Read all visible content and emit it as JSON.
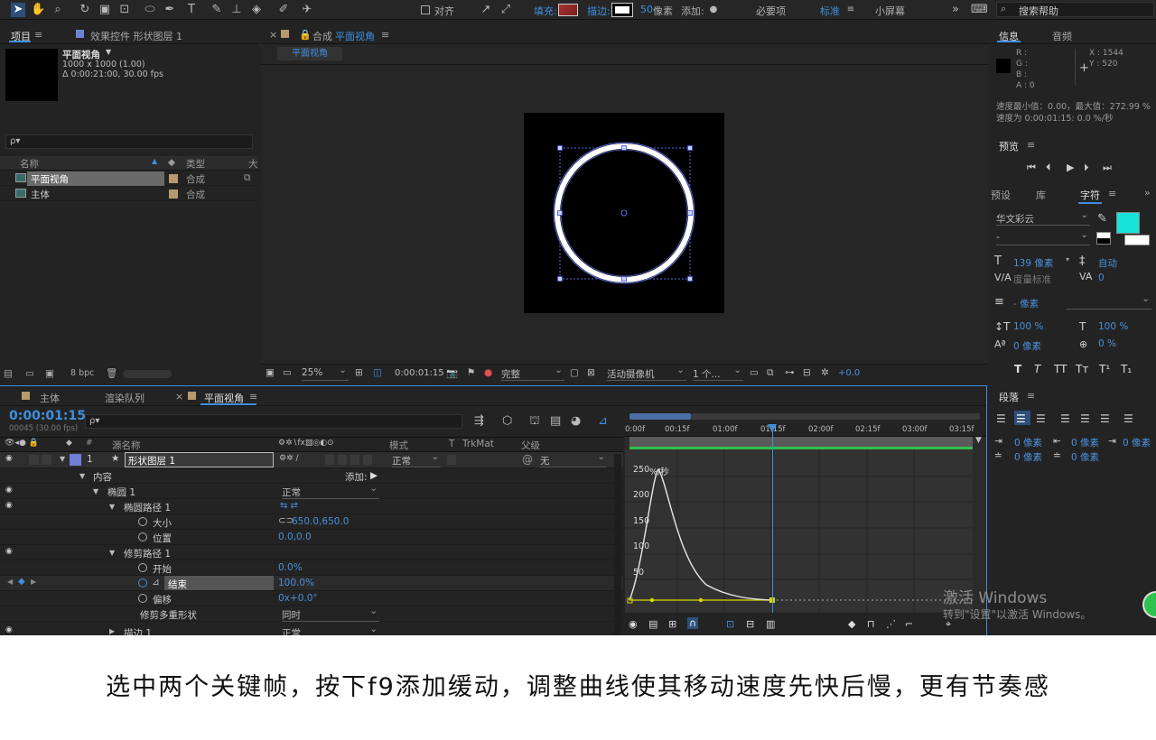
{
  "toolbar": {
    "align_label": "对齐",
    "fill_label": "填充:",
    "stroke_label": "描边:",
    "stroke_width": "50",
    "stroke_unit": "像素",
    "add_label": "添加:",
    "workspaces": [
      "必要项",
      "标准",
      "小屏幕"
    ],
    "search_placeholder": "搜索帮助"
  },
  "project_panel": {
    "tab_project": "项目",
    "tab_effects": "效果控件 形状图层 1",
    "comp_name": "平面视角",
    "comp_dims": "1000 x 1000 (1.00)",
    "comp_duration": "Δ 0:00:21:00, 30.00 fps",
    "search_placeholder": "ρ▾",
    "col_name": "名称",
    "col_type": "类型",
    "col_size": "大",
    "items": [
      {
        "name": "平面视角",
        "type": "合成"
      },
      {
        "name": "主体",
        "type": "合成"
      }
    ],
    "bpc": "8 bpc"
  },
  "comp_panel": {
    "tab_prefix": "合成",
    "tab_name": "平面视角",
    "sub_tab": "平面视角",
    "zoom": "25%",
    "timecode": "0:00:01:15",
    "quality": "完整",
    "camera": "活动摄像机",
    "views": "1 个...",
    "exposure": "+0.0"
  },
  "info_panel": {
    "tab_info": "信息",
    "tab_audio": "音频",
    "r": "R :",
    "g": "G :",
    "b": "B :",
    "a": "A : 0",
    "x": "X : 1544",
    "y": "Y : 520",
    "speed_line1": "速度最小值：0.00，最大值：272.99 %",
    "speed_line2": "速度为 0:00:01:15: 0.0 %/秒"
  },
  "preview_panel": {
    "title": "预览"
  },
  "char_panel": {
    "tab_presets": "预设",
    "tab_library": "库",
    "tab_character": "字符",
    "font": "华文彩云",
    "style": "-",
    "size": "139 像素",
    "leading": "自动",
    "kerning": "度量标准",
    "tracking": "0",
    "stroke_width": "- 像素",
    "vscale": "100 %",
    "hscale": "100 %",
    "baseline": "0 像素",
    "tsume": "0 %",
    "fill_color": "#15e5d8"
  },
  "para_panel": {
    "title": "段落",
    "indent_left": "0 像素",
    "indent_right": "0 像素",
    "indent_first": "0 像素",
    "space_before": "0 像素",
    "space_after": "0 像素"
  },
  "timeline": {
    "tabs": [
      "主体",
      "渲染队列",
      "平面视角"
    ],
    "timecode": "0:00:01:15",
    "frame_info": "00045 (30.00 fps)",
    "col_source": "源名称",
    "col_mode": "模式",
    "col_t": "T",
    "col_trkmat": "TrkMat",
    "col_parent": "父级",
    "layer_num": "1",
    "layer_name": "形状图层 1",
    "layer_mode": "正常",
    "layer_parent": "无",
    "rows": [
      {
        "label": "内容",
        "value": "添加:"
      },
      {
        "label": "椭圆 1",
        "value": "正常"
      },
      {
        "label": "椭圆路径 1",
        "value": ""
      },
      {
        "label": "大小",
        "value": "650.0,650.0"
      },
      {
        "label": "位置",
        "value": "0.0,0.0"
      },
      {
        "label": "修剪路径 1",
        "value": ""
      },
      {
        "label": "开始",
        "value": "0.0%"
      },
      {
        "label": "结束",
        "value": "100.0%"
      },
      {
        "label": "偏移",
        "value": "0x+0.0°"
      },
      {
        "label": "修剪多重形状",
        "value": "同时"
      },
      {
        "label": "描边 1",
        "value": "正常"
      }
    ],
    "ruler": [
      "0:00f",
      "00:15f",
      "01:00f",
      "01:15f",
      "02:00f",
      "02:15f",
      "03:00f",
      "03:15f"
    ],
    "graph_ticks": [
      "250",
      "200",
      "150",
      "100",
      "50"
    ],
    "graph_unit": "%/秒"
  },
  "watermark": {
    "line1": "激活 Windows",
    "line2": "转到\"设置\"以激活 Windows。"
  },
  "caption": "选中两个关键帧，按下f9添加缓动，调整曲线使其移动速度先快后慢，更有节奏感"
}
